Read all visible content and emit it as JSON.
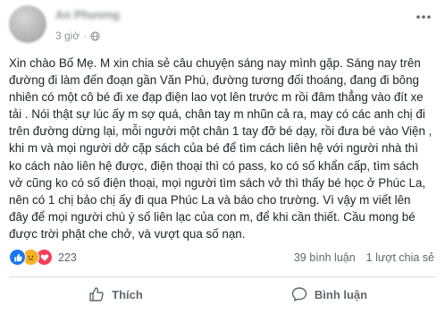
{
  "header": {
    "author_name": "An Phương",
    "timestamp": "3 giờ",
    "separator": "·"
  },
  "post": {
    "text": "Xin chào Bố Mẹ. M xin chia sẻ câu chuyện sáng nay mình gặp. Sáng nay trên đường đi làm đến đoạn gần Văn Phú, đường tương đối thoáng, đang đi bông nhiên có một cô bé đi xe đạp điện lao vọt lên trước m rồi đâm thẳng vào đít xe tải . Nói thật sự lúc ấy m sợ quá, chân tay m nhũn cả ra, may có các anh chị đi trên đường dừng lại, mỗi người một chân 1 tay đỡ bé dạy, rồi đưa bé vào Viện , khi m và mọi người dở cặp sách của bé để tìm cách liên hệ với người nhà thì ko cách nào liên hệ được, điện thoại thì có pass, ko có số khẩn cấp, tìm sách vở cũng ko có số điện thoại, mọi người tìm sách vở thì thấy bé học ở Phúc La, nên có 1 chị bảo chị ấy đi qua Phúc La và báo cho trường. Vì vậy m viết lên đây để mọi người chú ý số liên lạc của con m, để khi cần thiết. Cầu mong bé được trời phật che chở, và vượt qua số nạn."
  },
  "reactions": {
    "count": "223",
    "icons": [
      "like-icon",
      "sad-icon",
      "love-icon"
    ]
  },
  "stats": {
    "comments": "39 bình luận",
    "shares": "1 lượt chia sẻ"
  },
  "actions": {
    "like_label": "Thích",
    "comment_label": "Bình luận"
  },
  "colors": {
    "accent": "#1877f2",
    "text": "#1d2129",
    "muted": "#606770",
    "divider": "#dadde1"
  }
}
